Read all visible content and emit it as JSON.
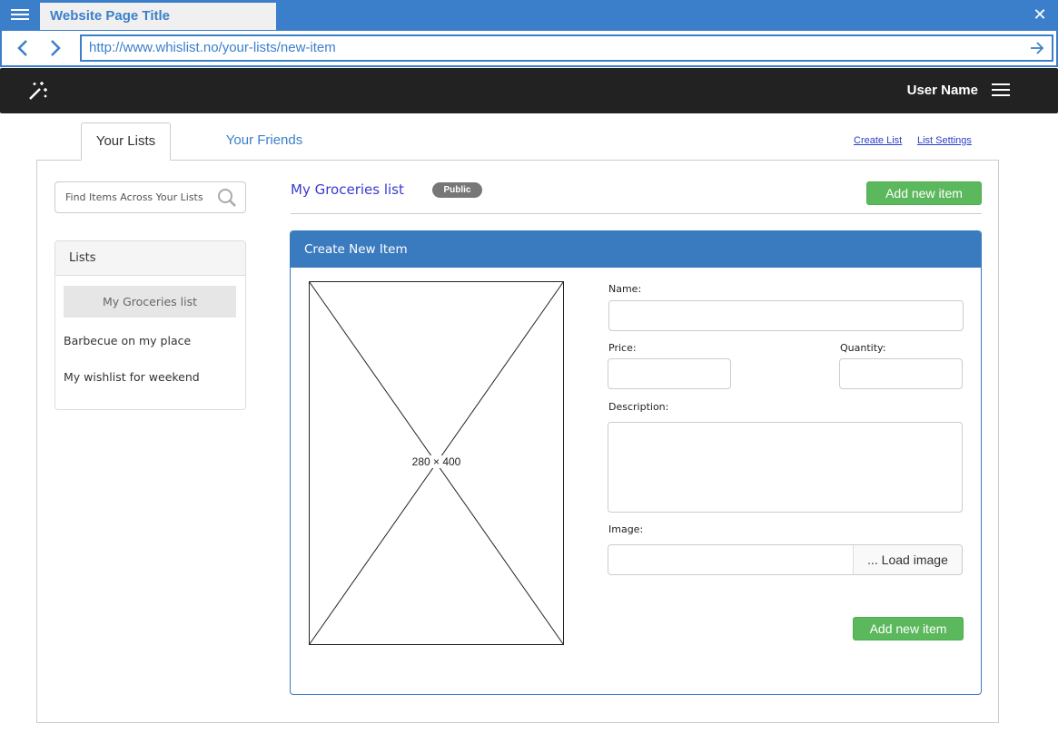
{
  "browser": {
    "tab_title": "Website Page Title",
    "url": "http://www.whislist.no/your-lists/new-item",
    "close_glyph": "✕"
  },
  "header": {
    "user_name": "User Name",
    "logo_icon": "magic-wand-icon"
  },
  "tabs": [
    {
      "label": "Your Lists",
      "active": true
    },
    {
      "label": "Your Friends",
      "active": false
    }
  ],
  "top_links": {
    "create_list": "Create List",
    "list_settings": "List Settings"
  },
  "sidebar": {
    "search_placeholder": "Find Items Across Your Lists",
    "lists_title": "Lists",
    "items": [
      {
        "label": "My Groceries list",
        "selected": true
      },
      {
        "label": "Barbecue on my place",
        "selected": false
      },
      {
        "label": "My wishlist for weekend",
        "selected": false
      }
    ]
  },
  "main": {
    "list_title": "My Groceries list",
    "badge": "Public",
    "add_button": "Add new item"
  },
  "form": {
    "title": "Create New Item",
    "image_caption": "280 × 400",
    "name_label": "Name:",
    "price_label": "Price:",
    "quantity_label": "Quantity:",
    "description_label": "Description:",
    "image_label": "Image:",
    "load_image": "... Load image",
    "submit": "Add new item"
  },
  "colors": {
    "chrome_blue": "#3b7fcb",
    "header_dark": "#222222",
    "panel_blue": "#3a7bbf",
    "button_green": "#5cb85c",
    "badge_gray": "#777777"
  }
}
